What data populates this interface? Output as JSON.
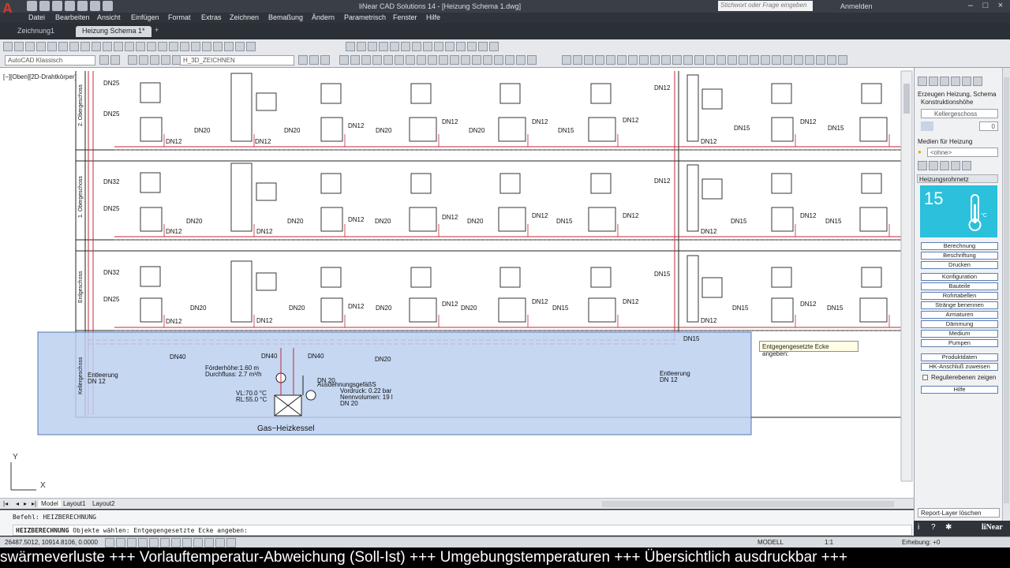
{
  "window": {
    "title": "liNear CAD Solutions 14 - [Heizung Schema 1.dwg]",
    "search_placeholder": "Stichwort oder Frage eingeben",
    "login_label": "Anmelden"
  },
  "menu": {
    "items": [
      "Datei",
      "Bearbeiten",
      "Ansicht",
      "Einfügen",
      "Format",
      "Extras",
      "Zeichnen",
      "Bemaßung",
      "Ändern",
      "Parametrisch",
      "Fenster",
      "Hilfe"
    ]
  },
  "tabs": {
    "items": [
      "Zeichnung1",
      "Heizung Schema 1*"
    ]
  },
  "toolbar": {
    "workspace": "AutoCAD Klassisch",
    "layer": "H_3D_ZEICHNEN"
  },
  "drawing": {
    "view_label": "[−][Oben][2D-Drahtkörper]",
    "floors": [
      "2. Obergeschoss",
      "1. Obergeschoss",
      "Erdgeschoss",
      "Kellergeschoss"
    ],
    "boiler_label": "Gas−Heizkessel",
    "pump_label1": "Förderhöhe:1.60 m",
    "pump_label2": "Durchfluss: 2.7 m³/h",
    "temp_label1": "VL:70.0 °C",
    "temp_label2": "RL:55.0 °C",
    "exp_label1": "AusdehnungsgefäßS",
    "exp_label2": "Vordruck: 0.22 bar",
    "exp_label3": "Nennvolumen: 19 l",
    "exp_label4": "DN 20",
    "drain_left": "Entleerung",
    "drain_left_dn": "DN 12",
    "drain_right": "Entleerung",
    "drain_right_dn": "DN 12",
    "dn_labels": {
      "dn25_a": "DN25",
      "dn25_b": "DN25",
      "dn32_a": "DN32",
      "dn25_c": "DN25",
      "dn32_b": "DN32",
      "dn25_d": "DN25",
      "dn12_floor": "DN12",
      "dn20": "DN20",
      "dn15": "DN15",
      "dn40": "DN40"
    },
    "axis_y": "Y",
    "axis_x": "X"
  },
  "tooltip": "Entgegengesetzte Ecke angeben:",
  "layout_tabs": [
    "Model",
    "Layout1",
    "Layout2"
  ],
  "command": {
    "line1": "Befehl: HEIZBERECHNUNG",
    "line2_cmd": "HEIZBERECHNUNG",
    "line2_rest": "Objekte wählen: Entgegengesetzte Ecke angeben:"
  },
  "status": {
    "coords": "26487.5012, 10914.8106, 0.0000",
    "model": "MODELL",
    "scale": "1:1",
    "elevation": "Erhebung: +0"
  },
  "panel": {
    "title1": "Erzeugen Heizung, Schema",
    "title2": "Konstruktionshöhe",
    "floor_select": "Kellergeschoss",
    "floor_value": "0",
    "medium_label": "Medien für Heizung",
    "medium_select": "<ohne>",
    "section": "Heizungsrohrnetz",
    "badge_number": "15",
    "buttons": [
      "Berechnung",
      "Beschriftung",
      "Drucken",
      "Konfiguration",
      "Bauteile",
      "Rohrtabellen",
      "Stränge benennen",
      "Armaturen",
      "Dämmung",
      "Medium",
      "Pumpen",
      "Produktdaten",
      "HK-Anschluß zuweisen"
    ],
    "checkbox_label": "Regulierebenen zeigen",
    "help_button": "Hilfe",
    "report_button": "Report-Layer löschen",
    "brand": "liNear"
  },
  "ticker": "swärmeverluste +++ Vorlauftemperatur-Abweichung (Soll-Ist) +++ Umgebungstemperaturen +++ Übersichtlich ausdruckbar +++"
}
